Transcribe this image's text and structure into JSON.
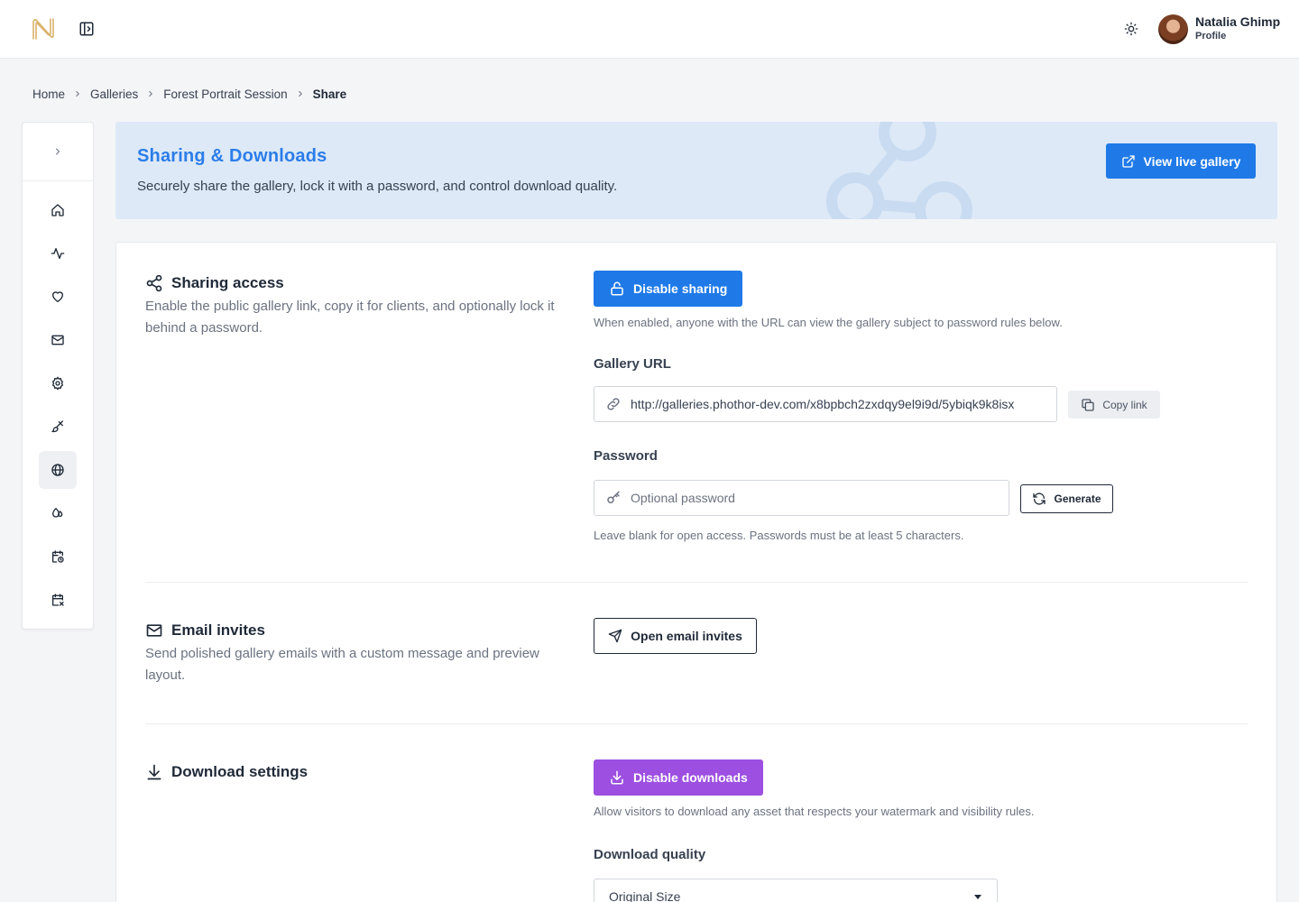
{
  "header": {
    "user_name": "Natalia Ghimp",
    "user_sub": "Profile",
    "icons": [
      "logo-n-icon",
      "sidebar-toggle-icon",
      "sun-icon"
    ]
  },
  "breadcrumb": {
    "items": [
      "Home",
      "Galleries",
      "Forest Portrait Session"
    ],
    "current": "Share"
  },
  "sidebar": {
    "items": [
      "home-icon",
      "activity-icon",
      "heart-icon",
      "mail-icon",
      "gear-icon",
      "brush-icon",
      "globe-icon",
      "drops-icon",
      "calendar-clock-icon",
      "calendar-x-icon"
    ],
    "active": "globe-icon"
  },
  "banner": {
    "title": "Sharing & Downloads",
    "subtitle": "Securely share the gallery, lock it with a password, and control download quality.",
    "live_button": "View live gallery"
  },
  "sharing": {
    "title": "Sharing access",
    "description": "Enable the public gallery link, copy it for clients, and optionally lock it behind a password.",
    "toggle_button": "Disable sharing",
    "toggle_help": "When enabled, anyone with the URL can view the gallery subject to password rules below.",
    "url_label": "Gallery URL",
    "url_value": "http://galleries.phothor-dev.com/x8bpbch2zxdqy9el9i9d/5ybiqk9k8isx",
    "copy_button": "Copy link",
    "password_label": "Password",
    "password_placeholder": "Optional password",
    "password_value": "",
    "generate_button": "Generate",
    "password_help": "Leave blank for open access. Passwords must be at least 5 characters."
  },
  "email": {
    "title": "Email invites",
    "description": "Send polished gallery emails with a custom message and preview layout.",
    "button": "Open email invites"
  },
  "downloads": {
    "title": "Download settings",
    "toggle_button": "Disable downloads",
    "toggle_help": "Allow visitors to download any asset that respects your watermark and visibility rules.",
    "quality_label": "Download quality",
    "quality_value": "Original Size"
  },
  "colors": {
    "primary_blue": "#1f7ae8",
    "banner_bg": "#dde9f7",
    "banner_title": "#2b7de9",
    "purple": "#9c4fe0",
    "logo_gold": "#d9b26b"
  }
}
